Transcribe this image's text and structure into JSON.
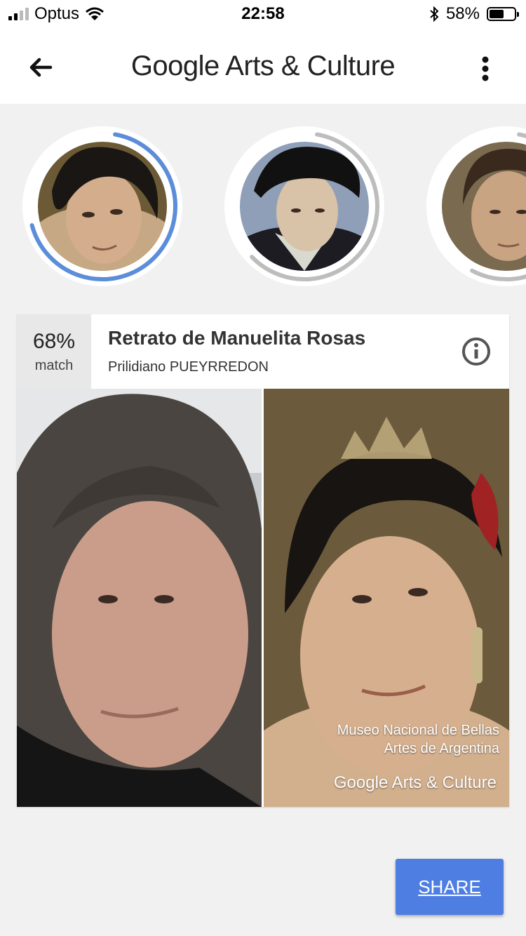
{
  "status_bar": {
    "carrier": "Optus",
    "time": "22:58",
    "battery": "58%",
    "battery_level": 0.58
  },
  "app_bar": {
    "brand_google": "Google",
    "brand_rest": "Arts & Culture"
  },
  "carousel": {
    "items": [
      {
        "match_fraction": 0.68,
        "selected": true,
        "ring_color": "#5b8dd9"
      },
      {
        "match_fraction": 0.6,
        "selected": false,
        "ring_color": "#bdbdbd"
      },
      {
        "match_fraction": 0.55,
        "selected": false,
        "ring_color": "#bdbdbd"
      }
    ]
  },
  "match_card": {
    "percent": "68%",
    "percent_label": "match",
    "title": "Retrato de Manuelita Rosas",
    "artist": "Prilidiano PUEYRREDON",
    "credit_line1": "Museo Nacional de Bellas",
    "credit_line2": "Artes de Argentina",
    "credit_brand": "Google Arts & Culture"
  },
  "share_button": {
    "label": "SHARE",
    "color": "#4f7ee3"
  }
}
